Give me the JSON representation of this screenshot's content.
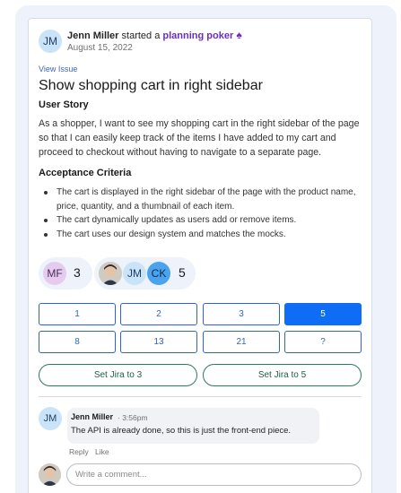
{
  "header": {
    "avatar_initials": "JM",
    "user_name": "Jenn Miller",
    "verb": "started a",
    "app_name": "planning poker",
    "app_icon": "spade-icon",
    "date": "August 15, 2022"
  },
  "issue": {
    "view_link": "View Issue",
    "title": "Show shopping cart in right sidebar",
    "story_heading": "User Story",
    "story_text": "As a shopper, I want to see my shopping cart in the right sidebar of the page so that I can easily keep track of the items I have added to my cart and proceed to checkout without having to navigate to a separate page.",
    "criteria_heading": "Acceptance Criteria",
    "criteria": [
      "The cart is displayed in the right sidebar of the page with the product name, price, quantity, and a thumbnail of each item.",
      "The cart dynamically updates as users add or remove items.",
      "The cart uses our design system and matches the mocks."
    ]
  },
  "votes": {
    "group1": {
      "avatars": [
        "MF"
      ],
      "count": "3"
    },
    "group2": {
      "avatars": [
        "photo",
        "JM",
        "CK"
      ],
      "count": "5"
    }
  },
  "cards": {
    "row1": [
      "1",
      "2",
      "3",
      "5"
    ],
    "row2": [
      "8",
      "13",
      "21",
      "?"
    ],
    "selected": "5"
  },
  "actions": {
    "jira_left": "Set Jira to 3",
    "jira_right": "Set Jira to 5"
  },
  "comment": {
    "avatar_initials": "JM",
    "author": "Jenn Miller",
    "time": "· 3:56pm",
    "text": "The API is already done, so this is just the front-end piece.",
    "reply_label": "Reply",
    "like_label": "Like"
  },
  "compose": {
    "placeholder": "Write a comment..."
  },
  "colors": {
    "accent": "#0f6cf5",
    "card_outline": "#2f64c6",
    "app_purple": "#6b2ec2",
    "jira_outline": "#2b7a63"
  }
}
